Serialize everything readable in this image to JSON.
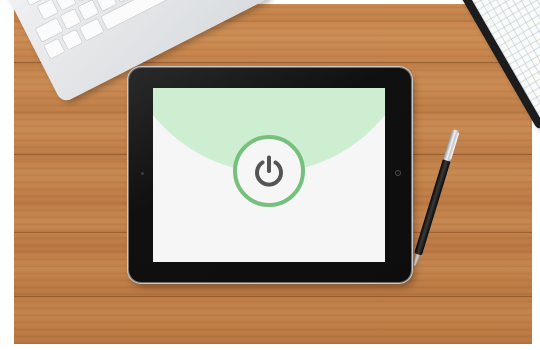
{
  "scene": {
    "objects": [
      "keyboard",
      "tablet",
      "pen",
      "notebook"
    ],
    "surface": "wooden-desk"
  },
  "tablet": {
    "screen": {
      "icon": "power-icon",
      "colors": {
        "top_panel": "#cdeed1",
        "background": "#f6f6f6",
        "ring": "#76c07d",
        "icon": "#545454"
      }
    }
  }
}
